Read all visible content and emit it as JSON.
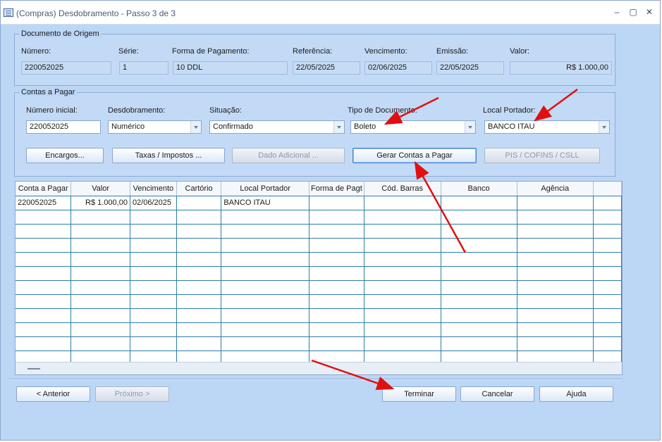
{
  "window": {
    "title": "(Compras) Desdobramento - Passo 3 de 3"
  },
  "origem": {
    "legend": "Documento de Origem",
    "labels": {
      "numero": "Número:",
      "serie": "Série:",
      "forma": "Forma de Pagamento:",
      "referencia": "Referência:",
      "vencimento": "Vencimento:",
      "emissao": "Emissão:",
      "valor": "Valor:"
    },
    "values": {
      "numero": "220052025",
      "serie": "1",
      "forma": "10 DDL",
      "referencia": "22/05/2025",
      "vencimento": "02/06/2025",
      "emissao": "22/05/2025",
      "valor": "R$ 1.000,00"
    }
  },
  "contas": {
    "legend": "Contas a Pagar",
    "labels": {
      "numero_inicial": "Número inicial:",
      "desdobramento": "Desdobramento:",
      "situacao": "Situação:",
      "tipo_documento": "Tipo de Documento:",
      "local_portador": "Local Portador:"
    },
    "values": {
      "numero_inicial": "220052025",
      "desdobramento": "Numérico",
      "situacao": "Confirmado",
      "tipo_documento": "Boleto",
      "local_portador": "BANCO ITAU"
    },
    "buttons": {
      "encargos": "Encargos...",
      "taxas": "Taxas / Impostos ...",
      "dado_adicional": "Dado Adicional ...",
      "gerar": "Gerar Contas a Pagar",
      "pis": "PIS / COFINS / CSLL"
    }
  },
  "grid": {
    "columns": [
      "Conta a Pagar",
      "Valor",
      "Vencimento",
      "Cartório",
      "Local Portador",
      "Forma de Pagt",
      "Cód. Barras",
      "Banco",
      "Agência"
    ],
    "rows": [
      [
        "220052025",
        "R$ 1.000,00",
        "02/06/2025",
        "",
        "BANCO ITAU",
        "",
        "",
        "",
        ""
      ]
    ]
  },
  "footer": {
    "anterior": "< Anterior",
    "proximo": "Próximo >",
    "terminar": "Terminar",
    "cancelar": "Cancelar",
    "ajuda": "Ajuda"
  },
  "colors": {
    "window_bg": "#bcd6f6",
    "grid_line": "#2c7fa8",
    "annotation_arrow": "#e01010"
  }
}
